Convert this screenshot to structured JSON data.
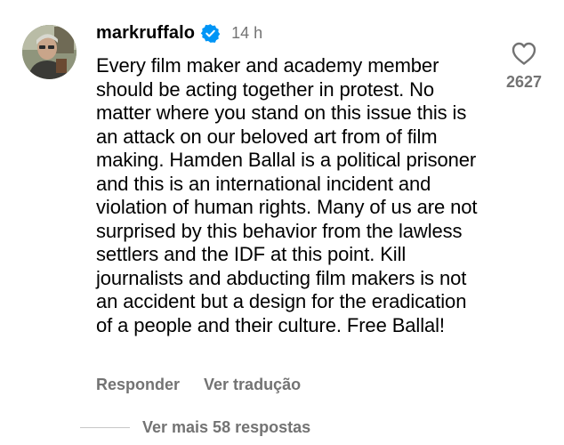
{
  "comment": {
    "username": "markruffalo",
    "verified_icon": "verified-badge-icon",
    "verified_color": "#0095f6",
    "timestamp": "14 h",
    "text": "Every film maker and academy member should be acting together in protest. No matter where you stand on this issue this is an attack on our beloved art from of film making. Hamden Ballal is a political prisoner and this is an international incident and violation of human rights. Many of us are not surprised by this behavior from the lawless settlers and the IDF at this point. Kill journalists and abducting film makers is not an accident but a design for the eradication of a people and their culture. Free Ballal!",
    "like_icon": "heart-outline-icon",
    "like_count": "2627",
    "actions": {
      "reply_label": "Responder",
      "translate_label": "Ver tradução"
    },
    "replies_label": "Ver mais 58 respostas"
  },
  "colors": {
    "text_primary": "#000000",
    "text_secondary": "#737373",
    "background": "#ffffff"
  }
}
